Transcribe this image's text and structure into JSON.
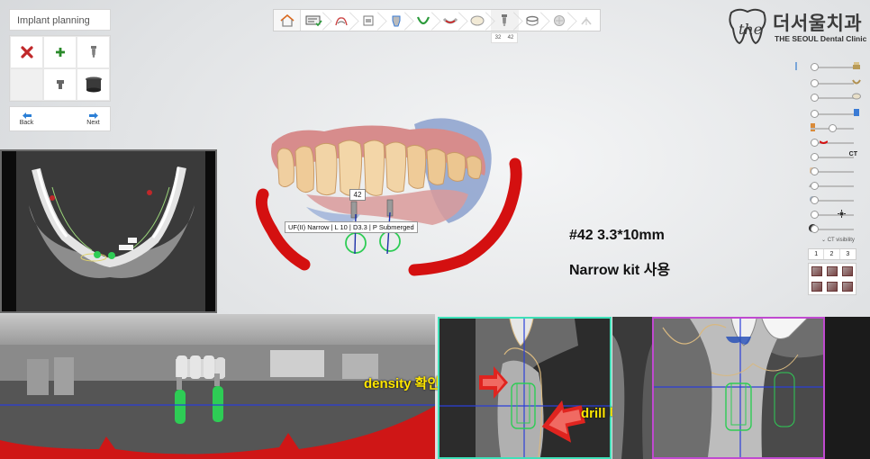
{
  "panel": {
    "title": "Implant planning",
    "back_label": "Back",
    "next_label": "Next"
  },
  "tools": [
    {
      "icon": "delete-x-icon"
    },
    {
      "icon": "add-plus-icon"
    },
    {
      "icon": "implant-small-icon"
    },
    {
      "icon": "empty"
    },
    {
      "icon": "abutment-icon"
    },
    {
      "icon": "sleeve-icon"
    }
  ],
  "toolbar": {
    "steps": [
      "home",
      "patient-info",
      "scan-data",
      "ct-data",
      "align",
      "arch-curve",
      "canal",
      "tooth-library",
      "implant",
      "sleeve",
      "guide",
      "export"
    ],
    "active_step": "implant",
    "sub_tabs": [
      "32",
      "42"
    ]
  },
  "logo": {
    "korean": "더서울치과",
    "english": "THE SEOUL Dental Clinic"
  },
  "visibility": {
    "ct_label": "CT",
    "ct_visibility_label": "CT visibility",
    "ct_tabs": [
      "1",
      "2",
      "3"
    ]
  },
  "annotations": {
    "spec": "#42 3.3*10mm",
    "kit": "Narrow kit 사용",
    "density": "density 확인",
    "drill": "drill 미끌림주의"
  },
  "model": {
    "tooth_tag": "42",
    "implant_label": "UF(II) Narrow | L 10 | D3.3 | P Submerged"
  },
  "colors": {
    "nerve_canal": "#d41010",
    "implant_green": "#2ecc55",
    "cross_section_teal": "#3fe0b8",
    "cross_section_magenta": "#c04ad0",
    "annotation_yellow": "#ffe600",
    "arrow_red": "#e0241f"
  }
}
